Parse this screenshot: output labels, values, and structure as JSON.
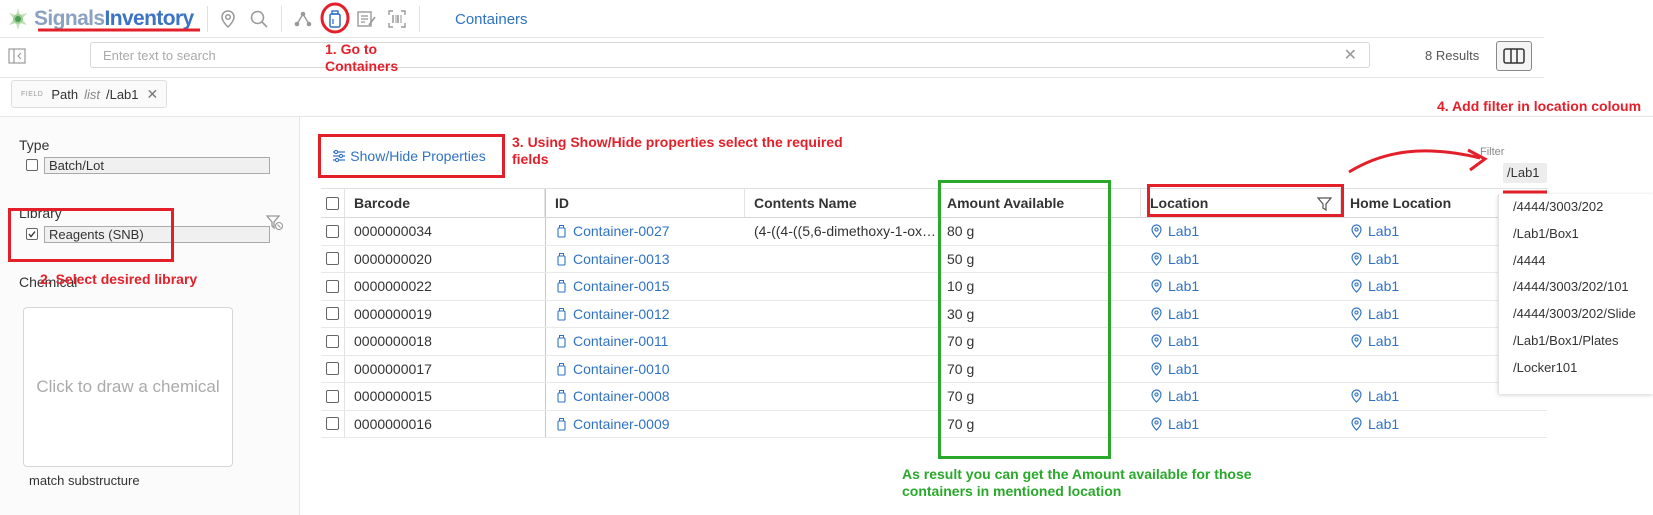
{
  "app": {
    "brand_part1": "Signals",
    "brand_part2": "Inventory",
    "nav_title": "Containers"
  },
  "search": {
    "placeholder": "Enter text to search",
    "results": "8 Results"
  },
  "filter_chip": {
    "kind": "FIELD",
    "field": "Path",
    "operator": "list",
    "value": "/Lab1"
  },
  "left_panel": {
    "type_label": "Type",
    "type_option": "Batch/Lot",
    "library_label": "Library",
    "library_option": "Reagents (SNB)",
    "chemical_label": "Chemical",
    "chemical_placeholder": "Click to draw a chemical",
    "match_label": "match substructure"
  },
  "show_hide_label": "Show/Hide Properties",
  "table": {
    "headers": {
      "barcode": "Barcode",
      "id": "ID",
      "contents_name": "Contents Name",
      "amount": "Amount Available",
      "location": "Location",
      "home_location": "Home Location"
    },
    "rows": [
      {
        "barcode": "0000000034",
        "id": "Container-0027",
        "contents": "(4-((4-((5,6-dimethoxy-1-ox…",
        "amount": "80 g",
        "location": "Lab1",
        "home": "Lab1"
      },
      {
        "barcode": "0000000020",
        "id": "Container-0013",
        "contents": "",
        "amount": "50 g",
        "location": "Lab1",
        "home": "Lab1"
      },
      {
        "barcode": "0000000022",
        "id": "Container-0015",
        "contents": "",
        "amount": "10 g",
        "location": "Lab1",
        "home": "Lab1"
      },
      {
        "barcode": "0000000019",
        "id": "Container-0012",
        "contents": "",
        "amount": "30 g",
        "location": "Lab1",
        "home": "Lab1"
      },
      {
        "barcode": "0000000018",
        "id": "Container-0011",
        "contents": "",
        "amount": "70 g",
        "location": "Lab1",
        "home": "Lab1"
      },
      {
        "barcode": "0000000017",
        "id": "Container-0010",
        "contents": "",
        "amount": "70 g",
        "location": "Lab1",
        "home": ""
      },
      {
        "barcode": "0000000015",
        "id": "Container-0008",
        "contents": "",
        "amount": "70 g",
        "location": "Lab1",
        "home": "Lab1"
      },
      {
        "barcode": "0000000016",
        "id": "Container-0009",
        "contents": "",
        "amount": "70 g",
        "location": "Lab1",
        "home": "Lab1"
      }
    ]
  },
  "location_filter": {
    "label": "Filter",
    "value": "/Lab1",
    "options": [
      "/4444/3003/202",
      "/Lab1/Box1",
      "/4444",
      "/4444/3003/202/101",
      "/4444/3003/202/Slide",
      "/Lab1/Box1/Plates",
      "/Locker101"
    ]
  },
  "annotations": {
    "step1": "1. Go to Containers",
    "step2": "2. Select desired library",
    "step3": "3. Using Show/Hide properties select the required fields",
    "step4": "4. Add filter in location coloum",
    "result": "As result you can get the Amount available for those containers in mentioned location"
  },
  "colors": {
    "brand": "#3b73c5",
    "link": "#2f72c4",
    "annotation_red": "#e3202a",
    "annotation_green": "#2aa82c"
  }
}
